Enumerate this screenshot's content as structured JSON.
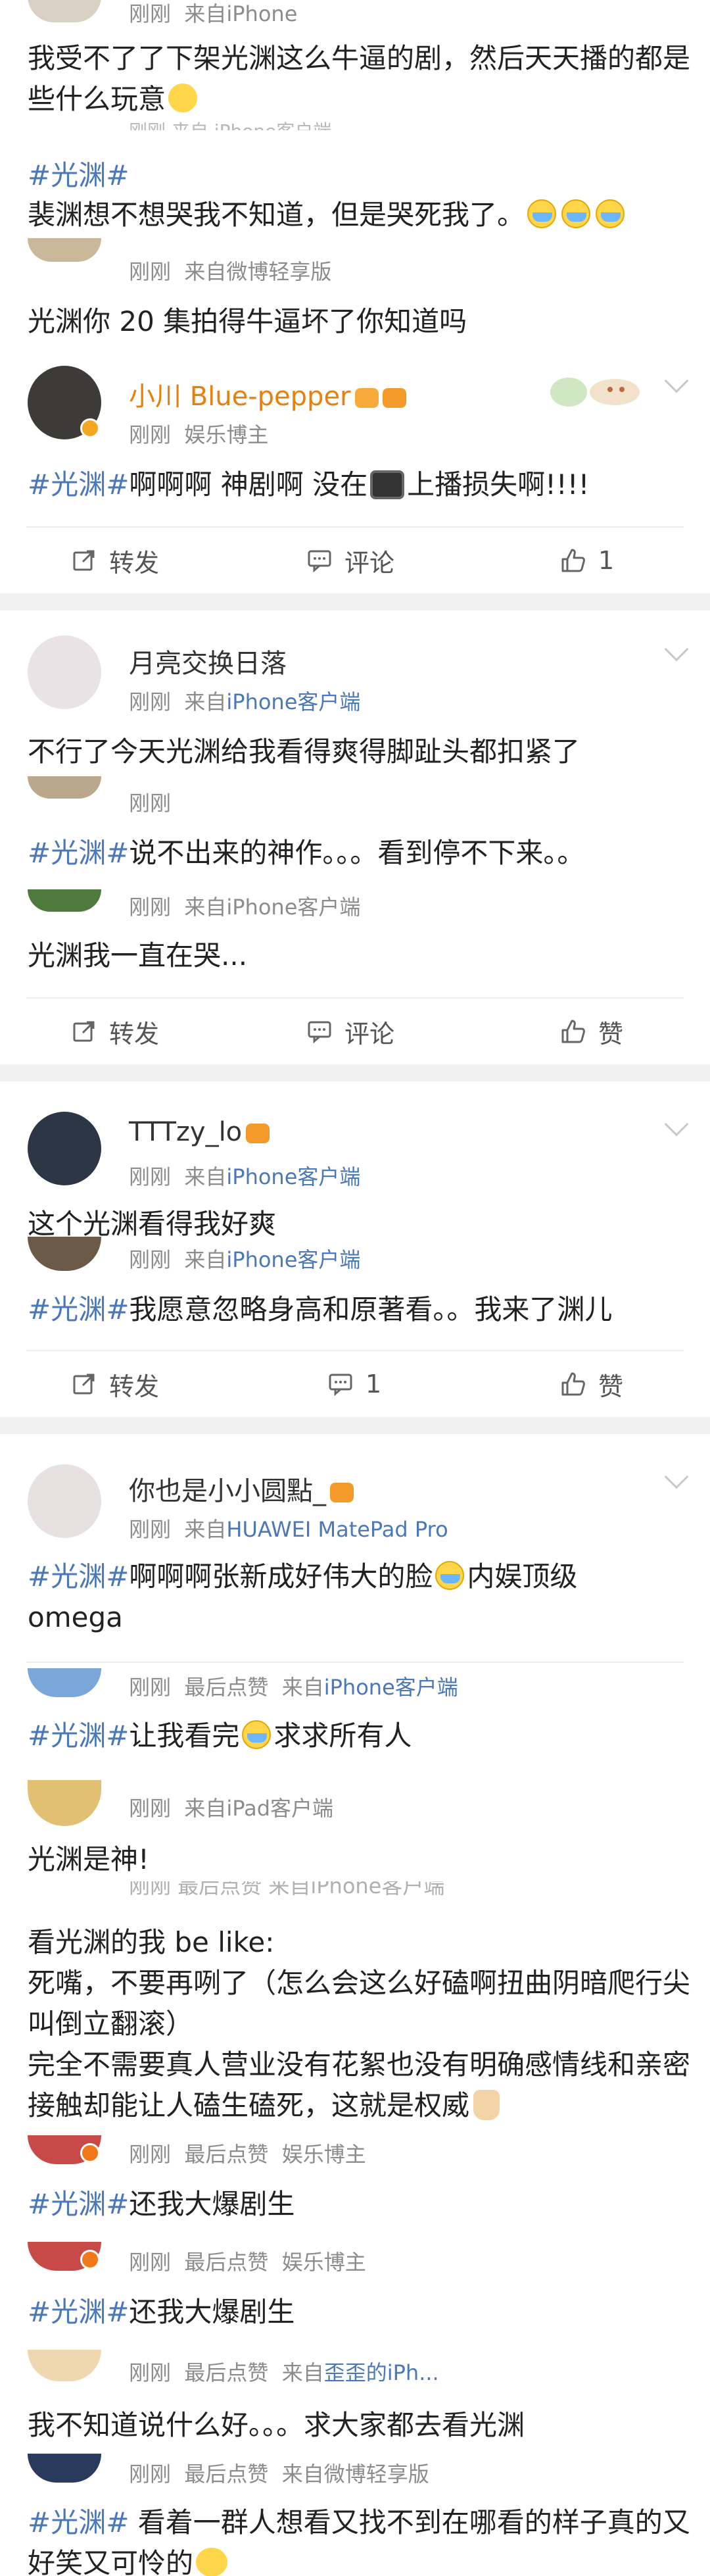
{
  "app": {
    "name": "Weibo feed"
  },
  "labels": {
    "just_now": "刚刚",
    "from": "来自",
    "latest_like": "最后点赞",
    "repost": "转发",
    "comment": "评论",
    "like": "赞"
  },
  "cards": [
    {
      "top_meta": {
        "time": "刚刚",
        "source": "来自iPhone"
      },
      "comments": [
        {
          "text": "我受不了了下架光渊这么牛逼的剧，然后天天播的都是些什么玩意"
        },
        {
          "meta": "刚刚  来自iPhone客户端",
          "hashtag": "#光渊#"
        },
        {
          "text": "裴渊想不想哭我不知道，但是哭死我了。"
        },
        {
          "meta_time": "刚刚",
          "meta_source": "来自微博轻享版",
          "text": "光渊你 20 集拍得牛逼坏了你知道吗"
        }
      ],
      "author": {
        "name": "小川 Blue-pepper",
        "time": "刚刚",
        "role": "娱乐博主"
      },
      "post": {
        "hashtag": "#光渊#",
        "text_a": "啊啊啊  神剧啊  没在",
        "text_b": "上播损失啊!!!!"
      },
      "actions": {
        "repost": "转发",
        "comment": "评论",
        "like_count": "1"
      }
    },
    {
      "author": {
        "name": "月亮交换日落",
        "time": "刚刚",
        "source": "来自",
        "source_link": "iPhone客户端"
      },
      "post": {
        "text": "不行了今天光渊给我看得爽得脚趾头都扣紧了"
      },
      "reply1": {
        "time": "刚刚",
        "hashtag": "#光渊#",
        "text": "说不出来的神作。。。看到停不下来。。"
      },
      "reply2": {
        "time": "刚刚",
        "source": "来自iPhone客户端",
        "text": "光渊我一直在哭..."
      },
      "actions": {
        "repost": "转发",
        "comment": "评论",
        "like": "赞"
      }
    },
    {
      "author": {
        "name": "TTTzy_lo",
        "time": "刚刚",
        "source": "来自",
        "source_link": "iPhone客户端"
      },
      "post": {
        "text": "这个光渊看得我好爽"
      },
      "reply1": {
        "time": "刚刚",
        "source": "来自",
        "source_link": "iPhone客户端",
        "hashtag": "#光渊#",
        "text": "我愿意忽略身高和原著看。。我来了渊儿"
      },
      "actions": {
        "repost": "转发",
        "comment_count": "1",
        "like": "赞"
      }
    },
    {
      "author": {
        "name": "你也是小小圆點_",
        "time": "刚刚",
        "source": "来自",
        "source_link": "HUAWEI MatePad Pro"
      },
      "post": {
        "hashtag": "#光渊#",
        "text_a": "啊啊啊张新成好伟大的脸",
        "text_b": "内娱顶级",
        "text_c": "omega"
      },
      "replies": [
        {
          "time": "刚刚",
          "extra": "最后点赞",
          "source": "来自",
          "source_link": "iPhone客户端",
          "hashtag": "#光渊#",
          "text_a": "让我看完",
          "text_b": "求求所有人"
        },
        {
          "time": "刚刚",
          "source": "来自iPad客户端",
          "text": "光渊是神!"
        },
        {
          "meta_partial": "刚刚  最后点赞  来自iPhone客户端",
          "line1": "看光渊的我 be like:",
          "line2": "死嘴，不要再咧了（怎么会这么好磕啊扭曲阴暗爬行尖叫倒立翻滚）",
          "line3": "完全不需要真人营业没有花絮也没有明确感情线和亲密接触却能让人磕生磕死，这就是权威"
        },
        {
          "time": "刚刚",
          "extra": "最后点赞",
          "role": "娱乐博主",
          "hashtag": "#光渊#",
          "text": "还我大爆剧生"
        },
        {
          "time": "刚刚",
          "extra": "最后点赞",
          "role": "娱乐博主",
          "hashtag": "#光渊#",
          "text": "还我大爆剧生"
        },
        {
          "time": "刚刚",
          "extra": "最后点赞",
          "source": "来自",
          "source_link": "歪歪的iPh...",
          "text": "我不知道说什么好。。。求大家都去看光渊"
        },
        {
          "time": "刚刚",
          "extra": "最后点赞",
          "source": "来自微博轻享版",
          "hashtag": "#光渊#",
          "text_a": " 看着一群人想看又找不到在哪看的样子真的又好笑又可怜的"
        }
      ]
    }
  ]
}
